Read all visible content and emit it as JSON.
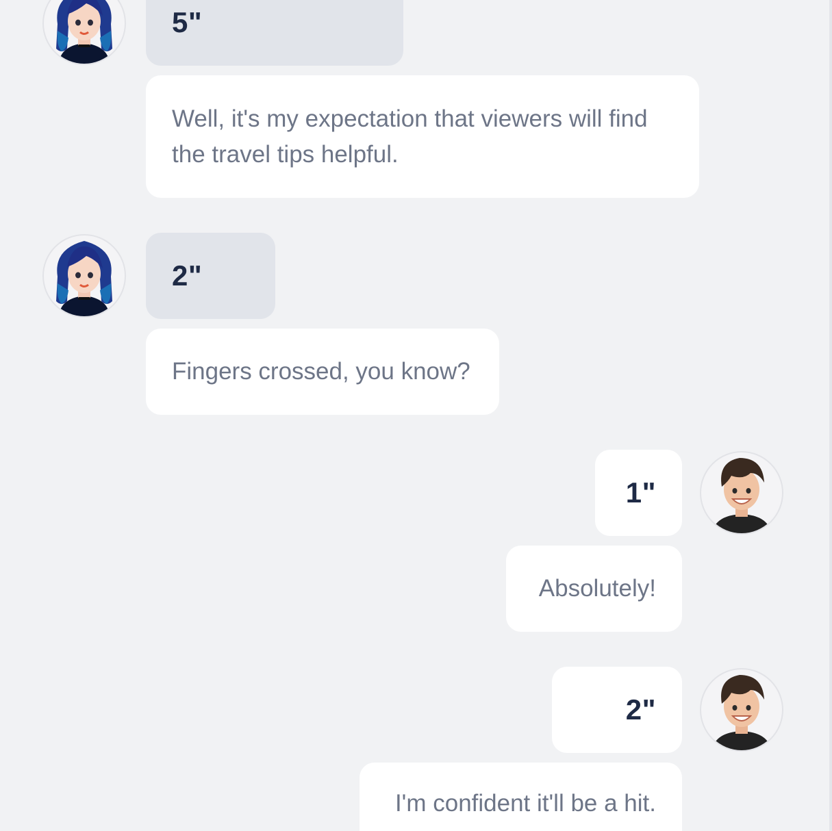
{
  "messages": [
    {
      "speaker": "female",
      "side": "left",
      "duration": "5\"",
      "text": "Well, it's my expectation that viewers will find the travel tips helpful."
    },
    {
      "speaker": "female",
      "side": "left",
      "duration": "2\"",
      "text": "Fingers crossed, you know?"
    },
    {
      "speaker": "male",
      "side": "right",
      "duration": "1\"",
      "text": "Absolutely!"
    },
    {
      "speaker": "male",
      "side": "right",
      "duration": "2\"",
      "text": "I'm confident it'll be a hit."
    }
  ],
  "colors": {
    "background": "#f1f2f4",
    "left_duration_bg": "#e1e4ea",
    "bubble_bg": "#ffffff",
    "duration_text": "#1e2a45",
    "message_text": "#6d7587"
  },
  "icons": {
    "female_avatar": "female-avatar-icon",
    "male_avatar": "male-avatar-icon"
  }
}
